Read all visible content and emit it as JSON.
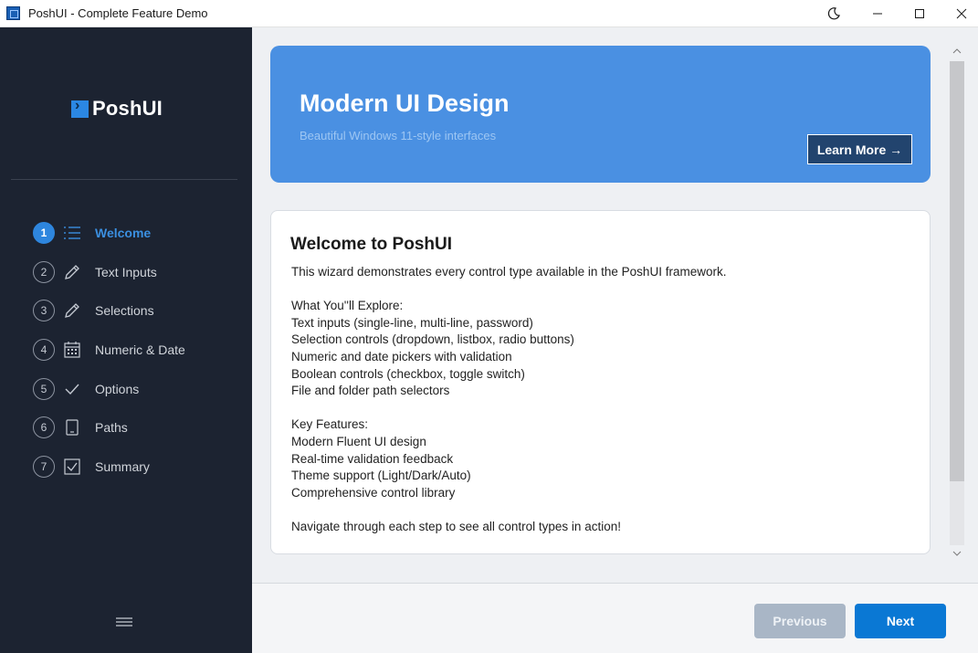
{
  "window": {
    "title": "PoshUI - Complete Feature Demo"
  },
  "sidebar": {
    "logo_text": "PoshUI",
    "items": [
      {
        "number": "1",
        "label": "Welcome",
        "icon": "list-icon",
        "active": true
      },
      {
        "number": "2",
        "label": "Text Inputs",
        "icon": "pencil-icon",
        "active": false
      },
      {
        "number": "3",
        "label": "Selections",
        "icon": "pencil-icon",
        "active": false
      },
      {
        "number": "4",
        "label": "Numeric & Date",
        "icon": "calendar-icon",
        "active": false
      },
      {
        "number": "5",
        "label": "Options",
        "icon": "checkmark-icon",
        "active": false
      },
      {
        "number": "6",
        "label": "Paths",
        "icon": "document-icon",
        "active": false
      },
      {
        "number": "7",
        "label": "Summary",
        "icon": "checkbox-icon",
        "active": false
      }
    ]
  },
  "hero": {
    "title": "Modern UI Design",
    "subtitle": "Beautiful Windows 11-style interfaces",
    "button_label": "Learn More →"
  },
  "card": {
    "title": "Welcome to PoshUI",
    "lines": [
      "This wizard demonstrates every control type available in the PoshUI framework.",
      "",
      "What You''ll Explore:",
      "Text inputs (single-line, multi-line, password)",
      "Selection controls (dropdown, listbox, radio buttons)",
      "Numeric and date pickers with validation",
      "Boolean controls (checkbox, toggle switch)",
      "File and folder path selectors",
      "",
      "Key Features:",
      "Modern Fluent UI design",
      "Real-time validation feedback",
      "Theme support (Light/Dark/Auto)",
      "Comprehensive control library",
      "",
      "Navigate through each step to see all control types in action!"
    ]
  },
  "footer": {
    "previous_label": "Previous",
    "next_label": "Next"
  },
  "colors": {
    "sidebar_bg": "#1c2331",
    "accent": "#0a78d4",
    "hero_bg": "#4a90e2",
    "active_step": "#2e86de"
  }
}
